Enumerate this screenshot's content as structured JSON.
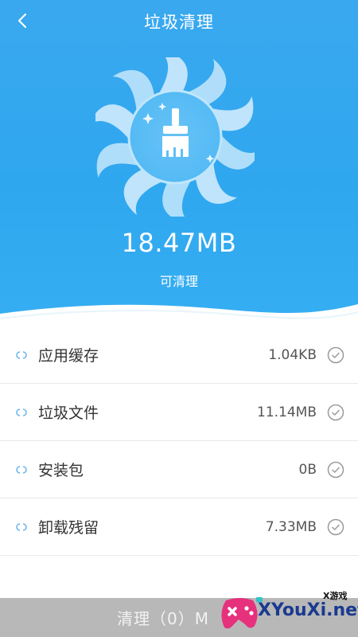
{
  "header": {
    "title": "垃圾清理"
  },
  "summary": {
    "size": "18.47MB",
    "label": "可清理"
  },
  "items": [
    {
      "label": "应用缓存",
      "size": "1.04KB"
    },
    {
      "label": "垃圾文件",
      "size": "11.14MB"
    },
    {
      "label": "安装包",
      "size": "0B"
    },
    {
      "label": "卸载残留",
      "size": "7.33MB"
    }
  ],
  "footer": {
    "button_label": "清理（0）M"
  },
  "watermark": {
    "site": "XYouXi.net",
    "small": "X游戏"
  },
  "colors": {
    "primary": "#2fa7ef",
    "button_bg": "#b8b8b8",
    "accent_logo": "#e6317d"
  }
}
